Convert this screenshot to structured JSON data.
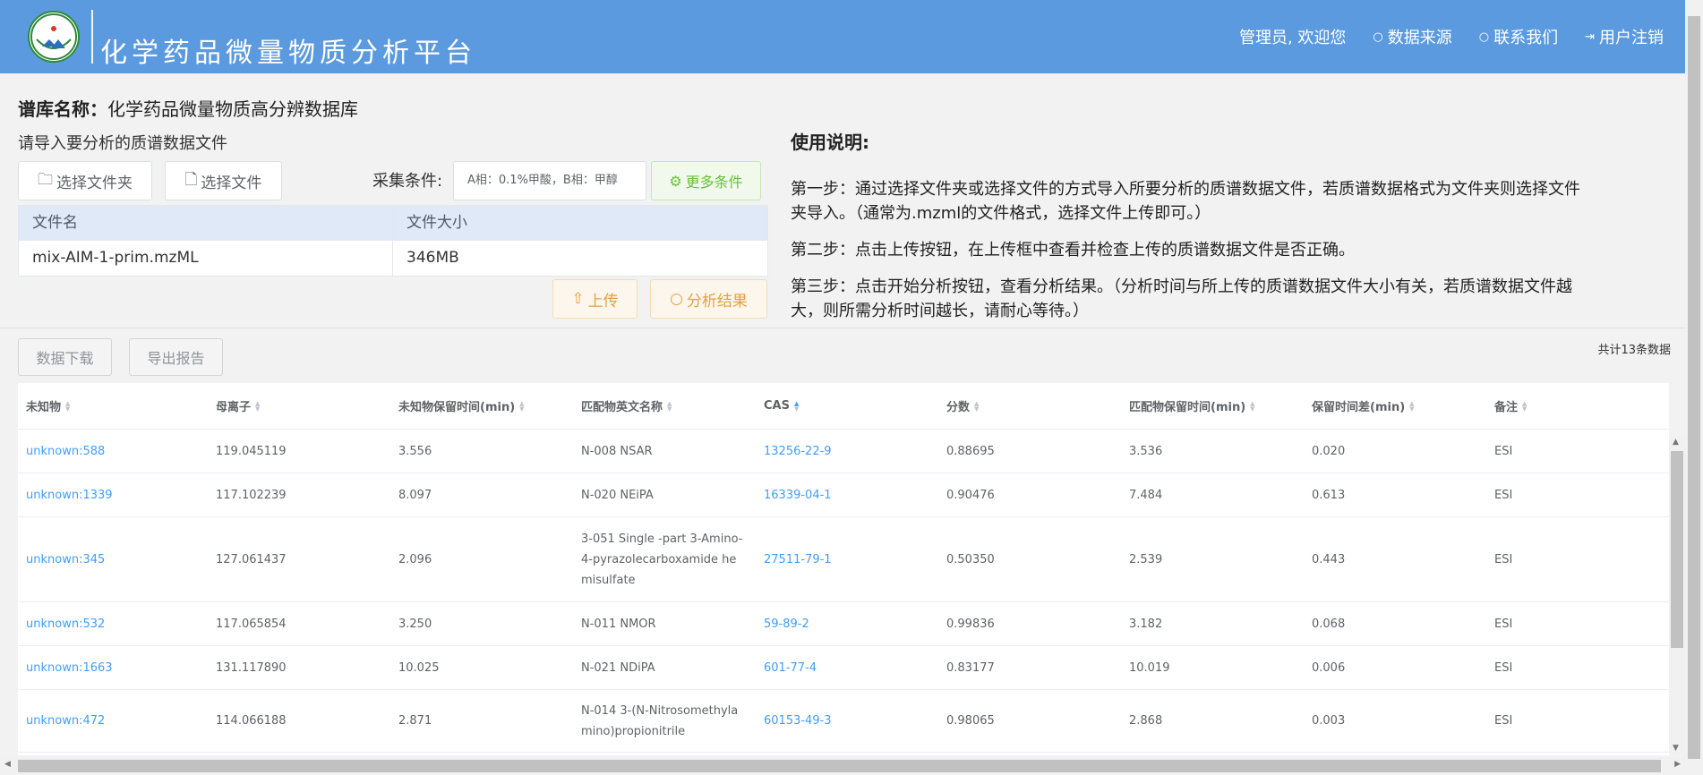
{
  "header": {
    "logo_text_top": "NIFDC",
    "logo_text_mid": "中国药检",
    "app_title": "化学药品微量物质分析平台",
    "nav": [
      {
        "label": "管理员, 欢迎您"
      },
      {
        "label": "数据来源"
      },
      {
        "label": "联系我们"
      },
      {
        "label": "用户注销"
      }
    ]
  },
  "library": {
    "label": "谱库名称：",
    "name": "化学药品微量物质高分辨数据库"
  },
  "import": {
    "hint": "请导入要分析的质谱数据文件",
    "folder_button": "选择文件夹",
    "file_button": "选择文件",
    "condition_label": "采集条件:",
    "condition_value": "A相：0.1%甲酸，B相：甲醇",
    "more_button": "更多条件",
    "upload_button": "上传",
    "analyze_button": "分析结果"
  },
  "file_table": {
    "headers": [
      "文件名",
      "文件大小"
    ],
    "rows": [
      [
        "mix-AIM-1-prim.mzML",
        "346MB"
      ]
    ]
  },
  "instructions": {
    "title": "使用说明:",
    "steps": [
      "第一步：通过选择文件夹或选择文件的方式导入所要分析的质谱数据文件，若质谱数据格式为文件夹则选择文件夹导入。（通常为.mzml的文件格式，选择文件上传即可。）",
      "第二步：点击上传按钮，在上传框中查看并检查上传的质谱数据文件是否正确。",
      "第三步：点击开始分析按钮，查看分析结果。（分析时间与所上传的质谱数据文件大小有关，若质谱数据文件越大，则所需分析时间越长，请耐心等待。）"
    ]
  },
  "results": {
    "download_button": "数据下载",
    "export_button": "导出报告",
    "total": "共计13条数据",
    "headers": [
      "未知物",
      "母离子",
      "未知物保留时间(min)",
      "匹配物英文名称",
      "CAS",
      "分数",
      "匹配物保留时间(min)",
      "保留时间差(min)",
      "备注"
    ],
    "rows": [
      {
        "unknown": "unknown:588",
        "precursor": "119.045119",
        "rt": "3.556",
        "name": "N-008 NSAR",
        "cas": "13256-22-9",
        "score": "0.88695",
        "match_rt": "3.536",
        "diff": "0.020",
        "note": "ESI"
      },
      {
        "unknown": "unknown:1339",
        "precursor": "117.102239",
        "rt": "8.097",
        "name": "N-020 NEiPA",
        "cas": "16339-04-1",
        "score": "0.90476",
        "match_rt": "7.484",
        "diff": "0.613",
        "note": "ESI"
      },
      {
        "unknown": "unknown:345",
        "precursor": "127.061437",
        "rt": "2.096",
        "name": "3-051 Single -part 3-Amino-4-pyrazolecarboxamide hemisulfate",
        "cas": "27511-79-1",
        "score": "0.50350",
        "match_rt": "2.539",
        "diff": "0.443",
        "note": "ESI"
      },
      {
        "unknown": "unknown:532",
        "precursor": "117.065854",
        "rt": "3.250",
        "name": "N-011 NMOR",
        "cas": "59-89-2",
        "score": "0.99836",
        "match_rt": "3.182",
        "diff": "0.068",
        "note": "ESI"
      },
      {
        "unknown": "unknown:1663",
        "precursor": "131.117890",
        "rt": "10.025",
        "name": "N-021 NDiPA",
        "cas": "601-77-4",
        "score": "0.83177",
        "match_rt": "10.019",
        "diff": "0.006",
        "note": "ESI"
      },
      {
        "unknown": "unknown:472",
        "precursor": "114.066188",
        "rt": "2.871",
        "name": "N-014 3-(N-Nitrosomethylamino)propionitrile",
        "cas": "60153-49-3",
        "score": "0.98065",
        "match_rt": "2.868",
        "diff": "0.003",
        "note": "ESI"
      }
    ]
  },
  "colors": {
    "header_bg": "#5b9ade",
    "link": "#409eff",
    "warning": "#e6a23c",
    "success": "#67c23a"
  }
}
